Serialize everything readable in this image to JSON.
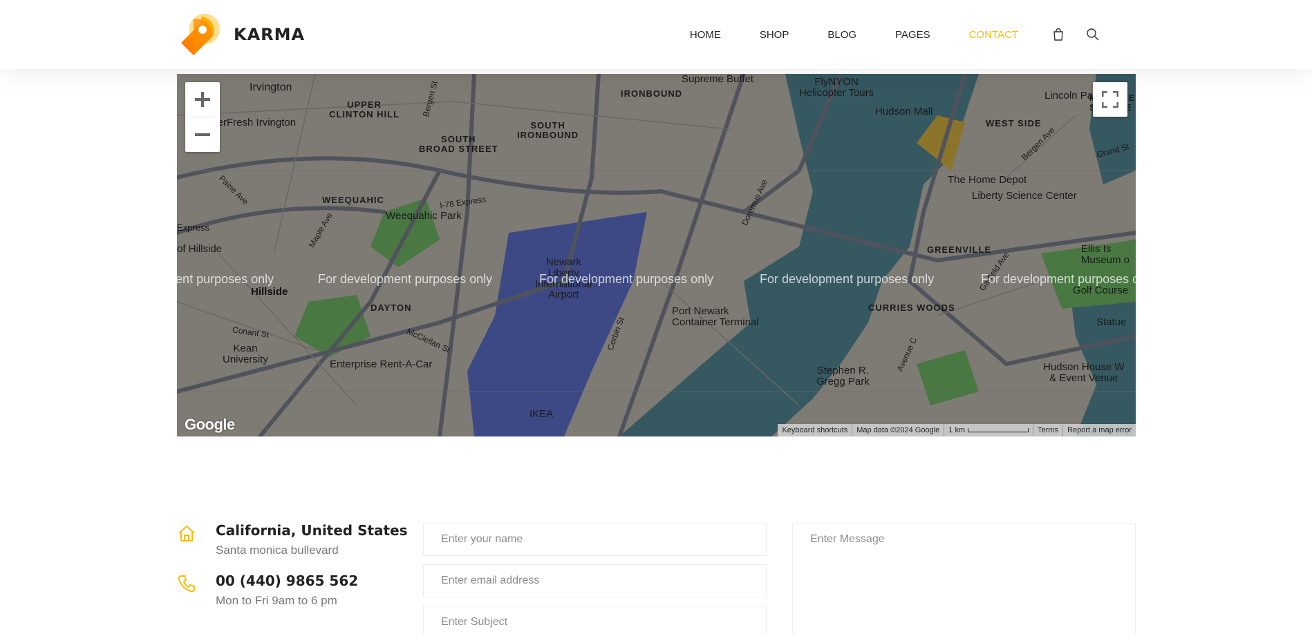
{
  "brand": {
    "name": "KARMA"
  },
  "nav": {
    "items": [
      {
        "label": "HOME",
        "active": false
      },
      {
        "label": "SHOP",
        "active": false
      },
      {
        "label": "BLOG",
        "active": false
      },
      {
        "label": "PAGES",
        "active": false
      },
      {
        "label": "CONTACT",
        "active": true
      }
    ],
    "icons": [
      "shopping-bag-icon",
      "search-icon"
    ],
    "accent_color": "#ffba00"
  },
  "map": {
    "dev_watermark": "For development purposes only",
    "logo": "Google",
    "attribution": {
      "shortcuts": "Keyboard shortcuts",
      "data": "Map data ©2024 Google",
      "scale": "1 km",
      "terms": "Terms",
      "report": "Report a map error"
    },
    "labels": {
      "irvington": "Irvington",
      "upper_clinton_hill": "UPPER\nCLINTON HILL",
      "south_broad_street": "SOUTH\nBROAD STREET",
      "south_ironbound": "SOUTH\nIRONBOUND",
      "ironbound": "IRONBOUND",
      "supreme_buffet": "Supreme Buffet",
      "flynyon": "FlyNYON\nHelicopter Tours",
      "hudson_mall": "Hudson Mall",
      "lincoln_park": "Lincoln Park",
      "mckinley_square": "MCKINLEY\nSQUARE",
      "west_side": "WEST SIDE",
      "superfresh": "uperFresh Irvington",
      "weequahic": "WEEQUAHIC",
      "weequahic_park": "Weequahic Park",
      "home_depot": "The Home Depot",
      "liberty_science": "Liberty Science Center",
      "greenville": "GREENVILLE",
      "newark_airport": "Newark\nLiberty\nInternational\nAirport",
      "hillside_loc": "of Hillside",
      "hillside": "Hillside",
      "dayton": "DAYTON",
      "port_newark": "Port Newark\nContainer Terminal",
      "curries_woods": "CURRIES WOODS",
      "kean": "Kean\nUniversity",
      "enterprise": "Enterprise Rent-A-Car",
      "stephen_gregg": "Stephen R.\nGregg Park",
      "hudson_house": "Hudson House W\n& Event Venue",
      "statue": "Statue",
      "ellis": "Ellis Is\nMuseum o",
      "golf": "Golf Course",
      "ikea": "IKEA",
      "express": "Express",
      "i78_express": "I-78 Express",
      "bergen_st": "Bergen St",
      "doremus": "Doremus Ave",
      "maple_ave": "Maple Ave",
      "paine_ave": "Paine Ave",
      "mcclellan": "McClellan St",
      "corbin": "Corbin St",
      "conant": "Conant St",
      "garfield": "Garfield Ave",
      "bergen_ave": "Bergen Ave",
      "grand_st": "Grand St",
      "avenue_c": "Avenue C"
    }
  },
  "contact": {
    "address_title": "California, United States",
    "address_sub": "Santa monica bullevard",
    "phone_title": "00 (440) 9865 562",
    "phone_sub": "Mon to Fri 9am to 6 pm"
  },
  "form": {
    "name_placeholder": "Enter your name",
    "email_placeholder": "Enter email address",
    "subject_placeholder": "Enter Subject",
    "message_placeholder": "Enter Message"
  }
}
